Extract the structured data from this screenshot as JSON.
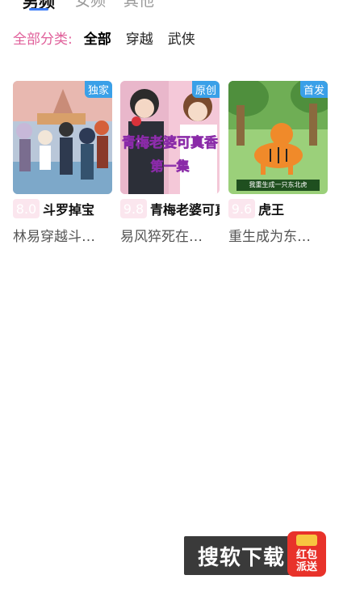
{
  "top_tabs": [
    {
      "label": "男频",
      "active": true
    },
    {
      "label": "女频",
      "active": false
    },
    {
      "label": "其他",
      "active": false
    }
  ],
  "categories": {
    "label": "全部分类:",
    "items": [
      {
        "label": "全部",
        "active": true
      },
      {
        "label": "穿越",
        "active": false
      },
      {
        "label": "武侠",
        "active": false
      }
    ]
  },
  "cards": [
    {
      "badge": "独家",
      "score": "8.0",
      "title": "斗罗掉宝",
      "desc": "林易穿越斗罗大陆"
    },
    {
      "badge": "原创",
      "score": "9.8",
      "title": "青梅老婆可真香",
      "desc": "易风猝死在工位上",
      "cover_caption": "青梅老婆可真香",
      "cover_episode": "第一集"
    },
    {
      "badge": "首发",
      "score": "9.6",
      "title": "虎王",
      "desc": "重生成为东北虎",
      "cover_caption": "我重生成一只东北虎"
    }
  ],
  "promo": {
    "text": "搜软下载",
    "red_label_1": "红包",
    "red_label_2": "派送"
  },
  "colors": {
    "accent_pink": "#e0609a",
    "tab_underline": "#3b7cf7",
    "badge_blue": "#3aa0e8",
    "score_bg": "#fbe6ee"
  }
}
